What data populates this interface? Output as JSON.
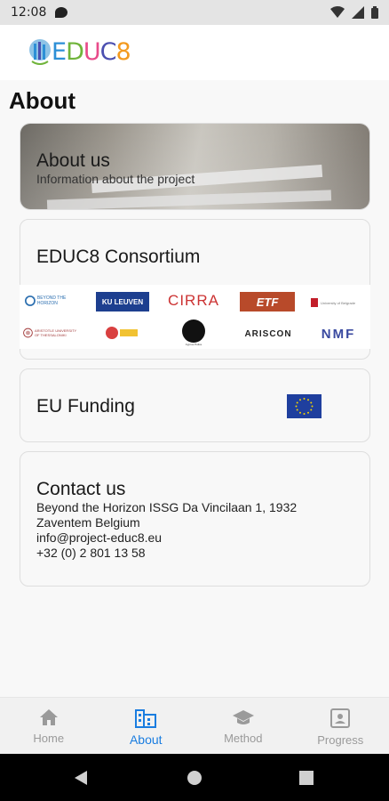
{
  "status_bar": {
    "time": "12:08",
    "icons": [
      "notification-icon",
      "wifi-icon",
      "signal-icon",
      "battery-icon"
    ]
  },
  "header": {
    "logo_text": "EDUC8",
    "logo_colors": {
      "E": "#2c8fd6",
      "D": "#6fb43a",
      "U": "#e84b8a",
      "C": "#4b4fb0",
      "8": "#f39a1f"
    }
  },
  "page": {
    "title": "About"
  },
  "about_card": {
    "title": "About us",
    "subtitle": "Information about the project"
  },
  "consortium_card": {
    "title": "EDUC8 Consortium",
    "partners": [
      {
        "name": "BEYOND THE HORIZON",
        "icon": "beyond-the-horizon-logo"
      },
      {
        "name": "KU LEUVEN",
        "icon": "ku-leuven-logo"
      },
      {
        "name": "CIRRA",
        "icon": "cirra-logo"
      },
      {
        "name": "ETF",
        "icon": "etf-logo"
      },
      {
        "name": "University of Belgrade",
        "icon": "university-logo"
      },
      {
        "name": "ARISTOTLE UNIVERSITY OF THESSALONIKI",
        "icon": "aristotle-university-logo"
      },
      {
        "name": "partner-logo",
        "icon": "seal-logo"
      },
      {
        "name": "Cyprus Police",
        "icon": "police-logo"
      },
      {
        "name": "ARISCON",
        "icon": "ariscon-logo"
      },
      {
        "name": "NMF",
        "icon": "nmf-logo"
      }
    ]
  },
  "funding_card": {
    "title": "EU Funding",
    "icon": "eu-flag-icon",
    "colors": {
      "flag_blue": "#1f3f9e",
      "stars": "#f5d300"
    }
  },
  "contact_card": {
    "title": "Contact us",
    "address_line1": "Beyond the Horizon ISSG Da Vincilaan 1, 1932",
    "address_line2": "Zaventem Belgium",
    "email": "info@project-educ8.eu",
    "phone": "+32 (0) 2 801 13 58"
  },
  "bottom_nav": {
    "active_color": "#1a7de0",
    "inactive_color": "#9a9a9a",
    "items": [
      {
        "label": "Home",
        "icon": "home-icon"
      },
      {
        "label": "About",
        "icon": "building-icon"
      },
      {
        "label": "Method",
        "icon": "graduation-cap-icon"
      },
      {
        "label": "Progress",
        "icon": "id-card-icon"
      }
    ]
  },
  "system_nav": {
    "buttons": [
      "back-icon",
      "home-circle-icon",
      "recents-icon"
    ]
  }
}
